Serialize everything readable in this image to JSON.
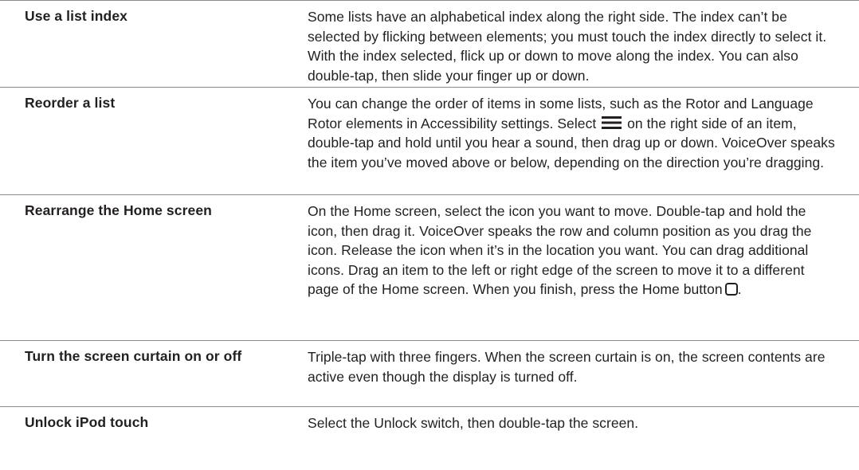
{
  "rows": [
    {
      "term": "Use a list index",
      "description": "Some lists have an alphabetical index along the right side. The index can’t be selected by flicking between elements; you must touch the index directly to select it. With the index selected, flick up or down to move along the index. You can also double-tap, then slide your finger up or down."
    },
    {
      "term": "Reorder a list",
      "description_before_icon": "You can change the order of items in some lists, such as the Rotor and Language Rotor elements in Accessibility settings. Select",
      "icon": "reorder-icon",
      "description_after_icon": "on the right side of an item, double-tap and hold until you hear a sound, then drag up or down. VoiceOver speaks the item you’ve moved above or below, depending on the direction you’re dragging."
    },
    {
      "term": "Rearrange the Home screen",
      "description_before_icon": "On the Home screen, select the icon you want to move. Double-tap and hold the icon, then drag it. VoiceOver speaks the row and column position as you drag the icon. Release the icon when it’s in the location you want. You can drag additional icons. Drag an item to the left or right edge of the screen to move it to a different page of the Home screen. When you finish, press the Home button",
      "icon": "home-button-icon",
      "description_after_icon": "."
    },
    {
      "term": "Turn the screen curtain on or off",
      "description": "Triple-tap with three fingers. When the screen curtain is on, the screen contents are active even though the display is turned off."
    },
    {
      "term": "Unlock iPod touch",
      "description": "Select the Unlock switch, then double-tap the screen."
    }
  ]
}
